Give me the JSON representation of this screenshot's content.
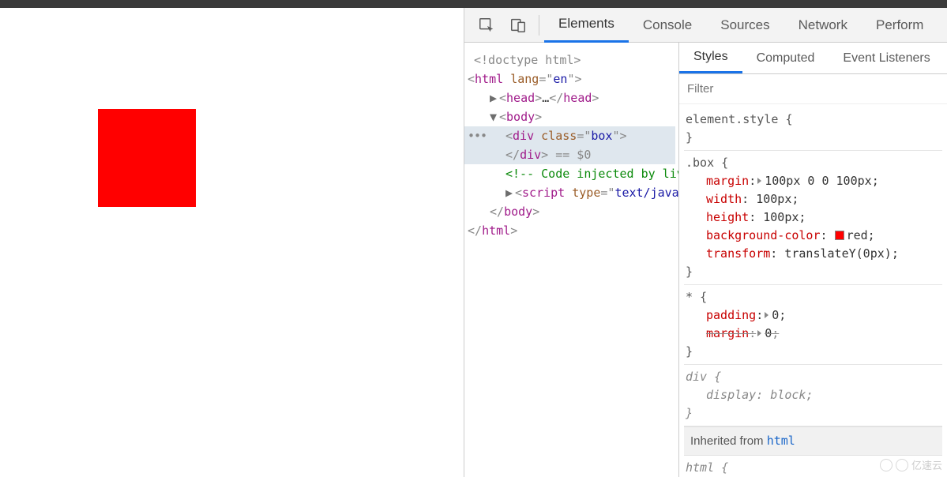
{
  "toolbar": {
    "tabs": [
      "Elements",
      "Console",
      "Sources",
      "Network",
      "Perform"
    ],
    "active_tab": "Elements"
  },
  "styles_tabs": {
    "tabs": [
      "Styles",
      "Computed",
      "Event Listeners"
    ],
    "active": "Styles"
  },
  "filter": {
    "placeholder": "Filter"
  },
  "dom": {
    "doctype": "<!doctype html>",
    "html_open": {
      "tag": "html",
      "attr_name": "lang",
      "attr_val": "en"
    },
    "head": {
      "tag": "head",
      "ellipsis": "…"
    },
    "body_open": {
      "tag": "body"
    },
    "div": {
      "tag": "div",
      "attr_name": "class",
      "attr_val": "box",
      "eq0": "== $0"
    },
    "comment": "<!-- Code injected by live-server -->",
    "script": {
      "tag": "script",
      "attr_name": "type",
      "attr_val": "text/javascript",
      "ellipsis": "…"
    },
    "body_close": {
      "tag": "body"
    },
    "html_close": {
      "tag": "html"
    }
  },
  "rules": {
    "element_style": {
      "selector": "element.style"
    },
    "box": {
      "selector": ".box",
      "margin": {
        "name": "margin",
        "value": "100px 0 0 100px"
      },
      "width": {
        "name": "width",
        "value": "100px"
      },
      "height": {
        "name": "height",
        "value": "100px"
      },
      "bg": {
        "name": "background-color",
        "value": "red"
      },
      "transform": {
        "name": "transform",
        "value": "translateY(0px)"
      }
    },
    "star": {
      "selector": "*",
      "padding": {
        "name": "padding",
        "value": "0"
      },
      "margin": {
        "name": "margin",
        "value": "0"
      }
    },
    "div_ua": {
      "selector": "div",
      "display": {
        "name": "display",
        "value": "block"
      }
    },
    "inherited_label": "Inherited from",
    "inherited_from": "html",
    "html_ua": {
      "selector": "html"
    }
  },
  "watermark": "亿速云"
}
